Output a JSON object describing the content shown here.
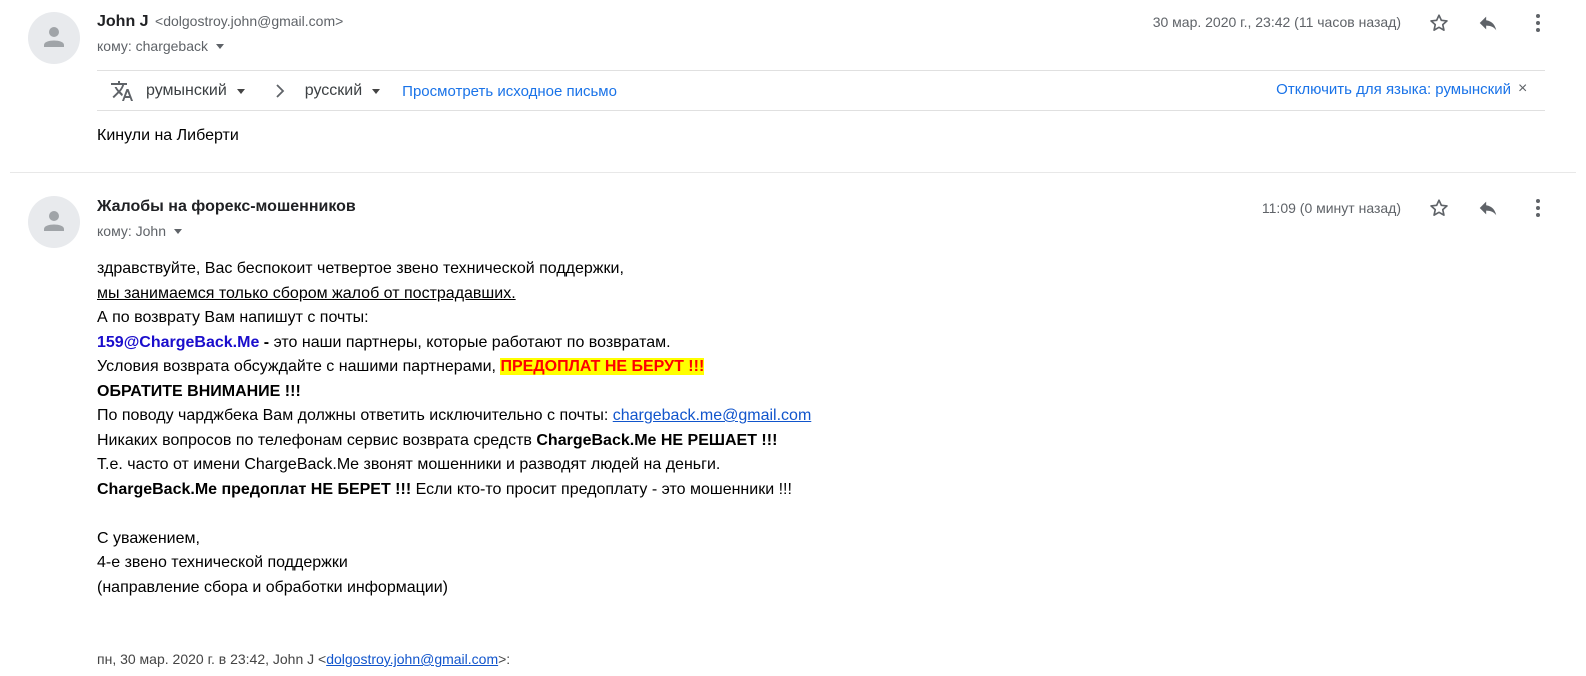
{
  "message1": {
    "sender_name": "John J",
    "sender_email": "<dolgostroy.john@gmail.com>",
    "to": "кому: chargeback",
    "date": "30 мар. 2020 г., 23:42 (11 часов назад)",
    "translate": {
      "from_lang": "румынский",
      "to_lang": "русский",
      "view_original": "Просмотреть исходное письмо",
      "disable_for": "Отключить для языка: румынский",
      "close": "×"
    },
    "body": "Кинули на Либерти"
  },
  "message2": {
    "sender_name": "Жалобы на форекс-мошенников",
    "to": "кому: John",
    "date": "11:09 (0 минут назад)",
    "body": {
      "l1": "здравствуйте, Вас беспокоит четвертое звено технической поддержки,",
      "l2": "мы занимаемся только сбором жалоб от пострадавших.",
      "l3": "А по возврату Вам напишут с почты:",
      "l4_email": "159@ChargeBack.Me",
      "l4_dash": " - ",
      "l4_rest": "это наши партнеры, которые работают по возвратам.",
      "l5_text": "Условия возврата обсуждайте с нашими партнерами, ",
      "l5_highlight": "ПРЕДОПЛАТ НЕ БЕРУТ !!!",
      "l6": "ОБРАТИТЕ ВНИМАНИЕ !!!",
      "l7_text": "По поводу чарджбека Вам должны ответить исключительно с почты: ",
      "l7_link": "chargeback.me@gmail.com",
      "l8_text": "Никаких вопросов по телефонам сервис возврата средств ",
      "l8_bold": "ChargeBack.Me НЕ РЕШАЕТ !!!",
      "l9": "Т.е. часто от имени ChargeBack.Me звонят мошенники и разводят людей на деньги.",
      "l10_bold": "ChargeBack.Me предоплат НЕ БЕРЕТ !!!",
      "l10_rest": " Если кто-то просит предоплату - это мошенники !!!",
      "sign1": "С уважением,",
      "sign2": "4-е звено технической поддержки",
      "sign3": "(направление сбора и обработки информации)"
    },
    "quote": {
      "prefix": "пн, 30 мар. 2020 г. в 23:42, John J <",
      "email": "dolgostroy.john@gmail.com",
      "suffix": ">:"
    }
  },
  "icons": {
    "star": "star-icon",
    "reply": "reply-icon",
    "more": "more-vert-icon",
    "translate": "translate-icon",
    "chevron": "chevron-right-icon",
    "avatar": "person-icon"
  },
  "colors": {
    "link": "#1a73e8",
    "mail_link": "#1155cc",
    "email_bold": "#1a0dcc",
    "highlight_bg": "#ffff00",
    "highlight_fg": "#ff0000"
  }
}
